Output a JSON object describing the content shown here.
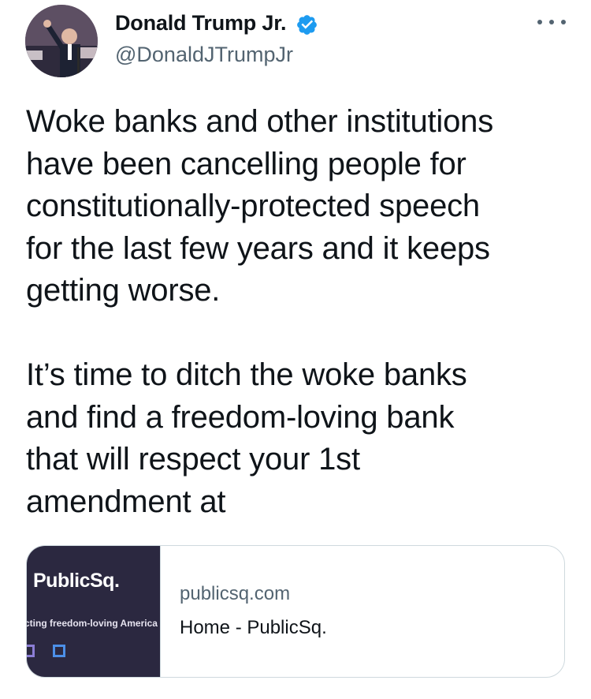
{
  "author": {
    "display_name": "Donald Trump Jr.",
    "handle": "@DonaldJTrumpJr",
    "verified": true,
    "avatar_icon": "profile-photo"
  },
  "menu": {
    "icon": "more-options-icon"
  },
  "tweet": {
    "text": "Woke banks and other institutions\nhave been cancelling people for\nconstitutionally-protected speech\nfor the last few years and it keeps\ngetting worse.\n\nIt’s time to ditch the woke banks\nand find a freedom-loving bank\nthat will respect your 1st\namendment at"
  },
  "link_card": {
    "thumbnail_logo": "PublicSq.",
    "thumbnail_tagline": "cting freedom-loving America",
    "domain": "publicsq.com",
    "title": "Home - PublicSq."
  },
  "colors": {
    "text": "#0f1419",
    "secondary": "#536471",
    "verified_blue": "#1d9bf0",
    "border": "#cfd9de",
    "thumb_bg": "#2b2840"
  }
}
